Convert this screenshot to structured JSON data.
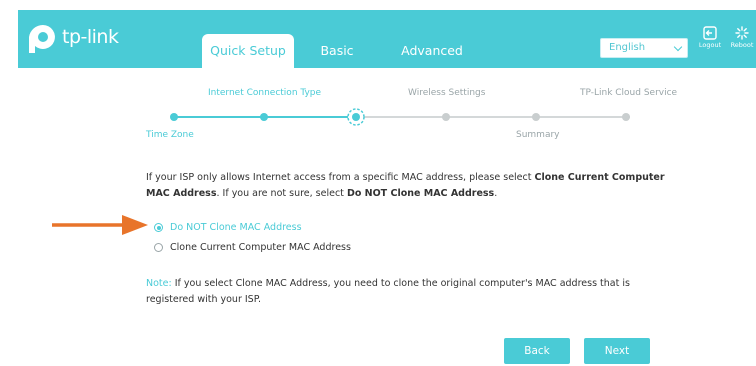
{
  "brand": {
    "logo_text": "tp-link"
  },
  "tabs": [
    {
      "label": "Quick Setup",
      "active": true
    },
    {
      "label": "Basic",
      "active": false
    },
    {
      "label": "Advanced",
      "active": false
    }
  ],
  "language": {
    "selected": "English"
  },
  "header_icons": {
    "logout": "Logout",
    "reboot": "Reboot"
  },
  "wizard": {
    "steps_top": [
      "Internet Connection Type",
      "Wireless Settings",
      "TP-Link Cloud Service"
    ],
    "steps_bottom": [
      "Time Zone",
      "Summary"
    ],
    "current_step": "Internet Connection Type"
  },
  "content": {
    "intro_part1": "If your ISP only allows Internet access from a specific MAC address, please select ",
    "intro_bold1": "Clone Current Computer MAC Address",
    "intro_part2": ". If you are not sure, select ",
    "intro_bold2": "Do NOT Clone MAC Address",
    "intro_part3": ".",
    "options": [
      {
        "label": "Do NOT Clone MAC Address",
        "checked": true
      },
      {
        "label": "Clone Current Computer MAC Address",
        "checked": false
      }
    ],
    "note_label": "Note:",
    "note_text": " If you select Clone MAC Address, you need to clone the original computer's MAC address that is registered with your ISP."
  },
  "buttons": {
    "back": "Back",
    "next": "Next"
  },
  "colors": {
    "accent": "#4acbd6",
    "arrow": "#e8742a",
    "muted": "#9aa5a8"
  }
}
